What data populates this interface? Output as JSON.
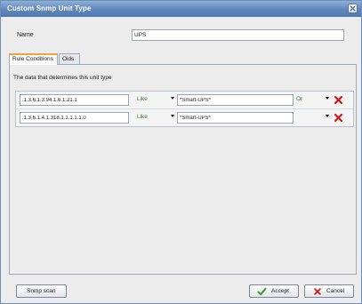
{
  "window": {
    "title": "Custom Snmp Unit Type"
  },
  "name_field": {
    "label": "Name",
    "value": "UPS"
  },
  "tabs": [
    {
      "label": "Rule Conditions",
      "active": true
    },
    {
      "label": "Oids",
      "active": false
    }
  ],
  "rule_conditions": {
    "description": "The data that determines this unit type",
    "rows": [
      {
        "oid": ".1.3.6.1.3.94.1.6.1.21.1",
        "operator": "Like",
        "pattern": "*Smart-UPS*",
        "conjunction": "Or"
      },
      {
        "oid": ".1.3.6.1.4.1.318.1.1.1.1.1.0",
        "operator": "Like",
        "pattern": "*Smart-UPS*",
        "conjunction": ""
      }
    ]
  },
  "buttons": {
    "snmp_scan": "Snmp scan",
    "accept": "Accept",
    "cancel": "Cancel"
  },
  "colors": {
    "title_bar": "#5f86bb",
    "active_tab_accent": "#f0a43a",
    "delete_icon": "#cc1a1a",
    "accept_icon": "#3c9a2e"
  },
  "icons": {
    "close": "close-icon",
    "delete": "delete-x-icon",
    "accept": "checkmark-icon",
    "cancel": "cancel-x-icon"
  }
}
